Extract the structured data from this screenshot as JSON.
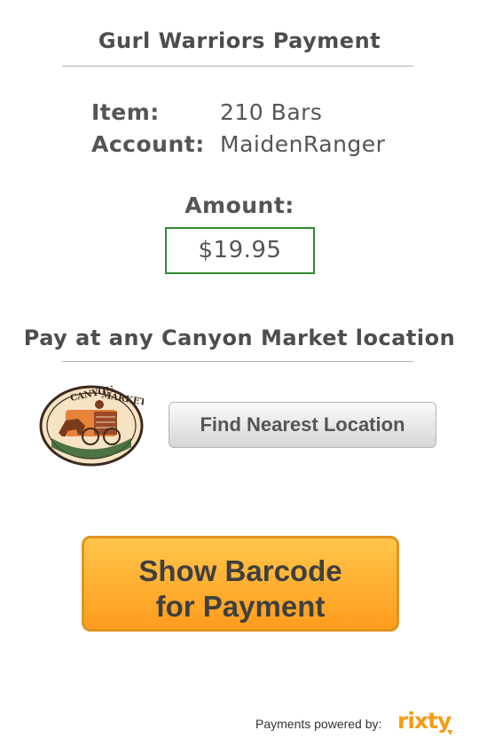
{
  "header": {
    "title": "Gurl Warriors Payment"
  },
  "details": {
    "item_label": "Item:",
    "item_value": "210 Bars",
    "account_label": "Account:",
    "account_value": "MaidenRanger"
  },
  "amount": {
    "label": "Amount:",
    "value": "$19.95"
  },
  "location": {
    "heading": "Pay at any Canyon Market location",
    "logo_text_top": "CANYON",
    "logo_text_top2": "MARKET",
    "find_button_label": "Find Nearest Location"
  },
  "actions": {
    "barcode_line1": "Show Barcode",
    "barcode_line2": "for Payment"
  },
  "footer": {
    "powered_by": "Payments powered by:",
    "brand": "rixty"
  },
  "colors": {
    "amount_border": "#2e8b2e",
    "barcode_button": "#ffb133",
    "brand": "#f39c12"
  }
}
